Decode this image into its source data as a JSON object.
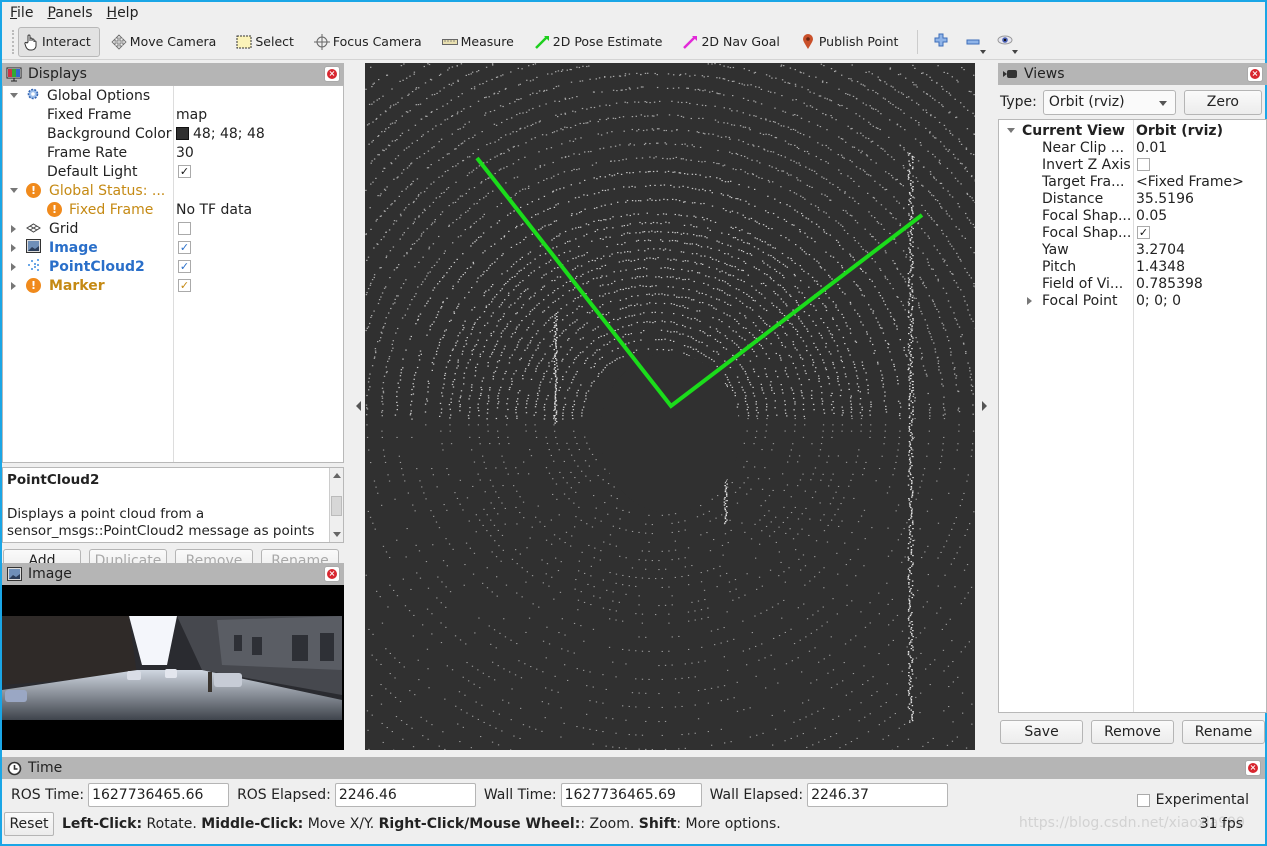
{
  "menu": [
    {
      "label": "File",
      "ul": "F",
      "rest": "ile"
    },
    {
      "label": "Panels",
      "ul": "P",
      "rest": "anels"
    },
    {
      "label": "Help",
      "ul": "H",
      "rest": "elp"
    }
  ],
  "toolbar": {
    "tools": [
      {
        "label": "Interact",
        "icon": "hand-icon",
        "active": true
      },
      {
        "label": "Move Camera",
        "icon": "move-camera-icon",
        "active": false
      },
      {
        "label": "Select",
        "icon": "select-icon",
        "active": false
      },
      {
        "label": "Focus Camera",
        "icon": "focus-camera-icon",
        "active": false
      },
      {
        "label": "Measure",
        "icon": "ruler-icon",
        "active": false
      },
      {
        "label": "2D Pose Estimate",
        "icon": "green-arrow-icon",
        "active": false
      },
      {
        "label": "2D Nav Goal",
        "icon": "magenta-arrow-icon",
        "active": false
      },
      {
        "label": "Publish Point",
        "icon": "map-pin-icon",
        "active": false
      }
    ],
    "extra": [
      "add-tool-icon",
      "remove-tool-icon",
      "eye-icon"
    ]
  },
  "displays": {
    "title": "Displays",
    "rows": [
      {
        "name": "Global Options",
        "value": ""
      },
      {
        "name": "Fixed Frame",
        "value": "map"
      },
      {
        "name": "Background Color",
        "value": "48; 48; 48"
      },
      {
        "name": "Frame Rate",
        "value": "30"
      },
      {
        "name": "Default Light",
        "value": "checked"
      },
      {
        "name": "Global Status: ...",
        "value": ""
      },
      {
        "name": "Fixed Frame",
        "value": "No TF data"
      },
      {
        "name": "Grid",
        "value": "unchecked"
      },
      {
        "name": "Image",
        "value": "checked"
      },
      {
        "name": "PointCloud2",
        "value": "checked"
      },
      {
        "name": "Marker",
        "value": "checked"
      }
    ],
    "description_title": "PointCloud2",
    "description_text": "Displays a point cloud from a sensor_msgs::PointCloud2 message as points in the world, drawn as points, billboards, or cubes.",
    "buttons": {
      "add": "Add",
      "duplicate": "Duplicate",
      "remove": "Remove",
      "rename": "Rename"
    }
  },
  "image_panel": {
    "title": "Image"
  },
  "views": {
    "title": "Views",
    "type_label": "Type:",
    "type_value": "Orbit (rviz)",
    "zero_label": "Zero",
    "current_view": {
      "name": "Current View",
      "value": "Orbit (rviz)"
    },
    "rows": [
      {
        "name": "Near Clip ...",
        "value": "0.01"
      },
      {
        "name": "Invert Z Axis",
        "value": "unchecked"
      },
      {
        "name": "Target Fra...",
        "value": "<Fixed Frame>"
      },
      {
        "name": "Distance",
        "value": "35.5196"
      },
      {
        "name": "Focal Shap...",
        "value": "0.05"
      },
      {
        "name": "Focal Shap...",
        "value": "checked"
      },
      {
        "name": "Yaw",
        "value": "3.2704"
      },
      {
        "name": "Pitch",
        "value": "1.4348"
      },
      {
        "name": "Field of Vi...",
        "value": "0.785398"
      },
      {
        "name": "Focal Point",
        "value": "0; 0; 0"
      }
    ],
    "buttons": {
      "save": "Save",
      "remove": "Remove",
      "rename": "Rename"
    }
  },
  "time": {
    "title": "Time",
    "ros_time_label": "ROS Time:",
    "ros_time": "1627736465.66",
    "ros_elapsed_label": "ROS Elapsed:",
    "ros_elapsed": "2246.46",
    "wall_time_label": "Wall Time:",
    "wall_time": "1627736465.69",
    "wall_elapsed_label": "Wall Elapsed:",
    "wall_elapsed": "2246.37",
    "experimental_label": "Experimental"
  },
  "status": {
    "reset_label": "Reset",
    "hint_parts": [
      {
        "bold": "Left-Click:",
        "text": " Rotate. "
      },
      {
        "bold": "Middle-Click:",
        "text": " Move X/Y. "
      },
      {
        "bold": "Right-Click/Mouse Wheel:",
        "text": ": Zoom. "
      },
      {
        "bold": "Shift",
        "text": ": More options."
      }
    ],
    "fps": "31 fps",
    "watermark": "https://blog.csdn.net/xiaoxia999"
  },
  "colors": {
    "background": "#303030",
    "marker_line": "#1bdc1b",
    "warning": "#f08a1c",
    "accent_blue": "#2a6fc9"
  }
}
